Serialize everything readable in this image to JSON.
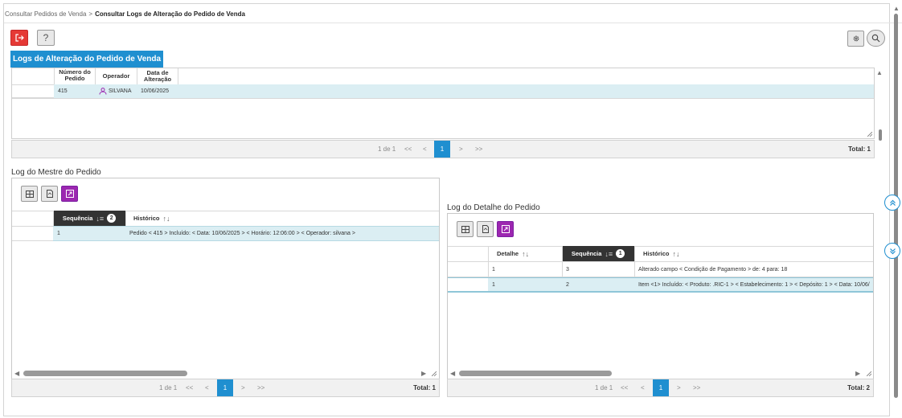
{
  "breadcrumb": {
    "parent": "Consultar Pedidos de Venda",
    "separator": ">",
    "current": "Consultar Logs de Alteração do Pedido de Venda"
  },
  "toolbar": {
    "help_label": "?"
  },
  "page_title": "Logs de Alteração do Pedido de Venda",
  "main_grid": {
    "columns": [
      "Número do Pedido",
      "Operador",
      "Data de Alteração"
    ],
    "rows": [
      {
        "numero": "415",
        "operador": "SILVANA",
        "data": "10/06/2025"
      }
    ],
    "pager": {
      "info": "1 de 1",
      "first": "<<",
      "prev": "<",
      "page": "1",
      "next": ">",
      "last": ">>",
      "total": "Total: 1"
    }
  },
  "mestre": {
    "title": "Log do Mestre do Pedido",
    "columns": {
      "sequencia": "Sequência",
      "sequencia_badge": "2",
      "historico": "Histórico"
    },
    "rows": [
      {
        "sequencia": "1",
        "historico": "Pedido < 415 > Incluído:  < Data: 10/06/2025 > < Horário: 12:06:00 > < Operador: silvana >"
      }
    ],
    "pager": {
      "info": "1 de 1",
      "first": "<<",
      "prev": "<",
      "page": "1",
      "next": ">",
      "last": ">>",
      "total": "Total: 1"
    }
  },
  "detalhe": {
    "title": "Log do Detalhe do Pedido",
    "columns": {
      "detalhe": "Detalhe",
      "sequencia": "Sequência",
      "sequencia_badge": "1",
      "historico": "Histórico"
    },
    "rows": [
      {
        "detalhe": "1",
        "sequencia": "3",
        "historico": "Alterado campo < Condição de Pagamento > de: 4 para: 18"
      },
      {
        "detalhe": "1",
        "sequencia": "2",
        "historico": "Item <1> Incluído: < Produto: .RIC-1 > < Estabelecimento: 1 > < Depósito: 1 > < Data: 10/06/"
      }
    ],
    "pager": {
      "info": "1 de 1",
      "first": "<<",
      "prev": "<",
      "page": "1",
      "next": ">",
      "last": ">>",
      "total": "Total: 2"
    }
  },
  "colors": {
    "accent": "#1f8fd0",
    "danger": "#e53935",
    "purple": "#9c27b0",
    "row_highlight": "#dbeef3"
  },
  "icons": [
    "exit-icon",
    "gear-icon",
    "search-icon",
    "grid-icon",
    "export-icon",
    "expand-icon",
    "user-icon",
    "chevrons-up-icon",
    "chevrons-down-icon"
  ]
}
